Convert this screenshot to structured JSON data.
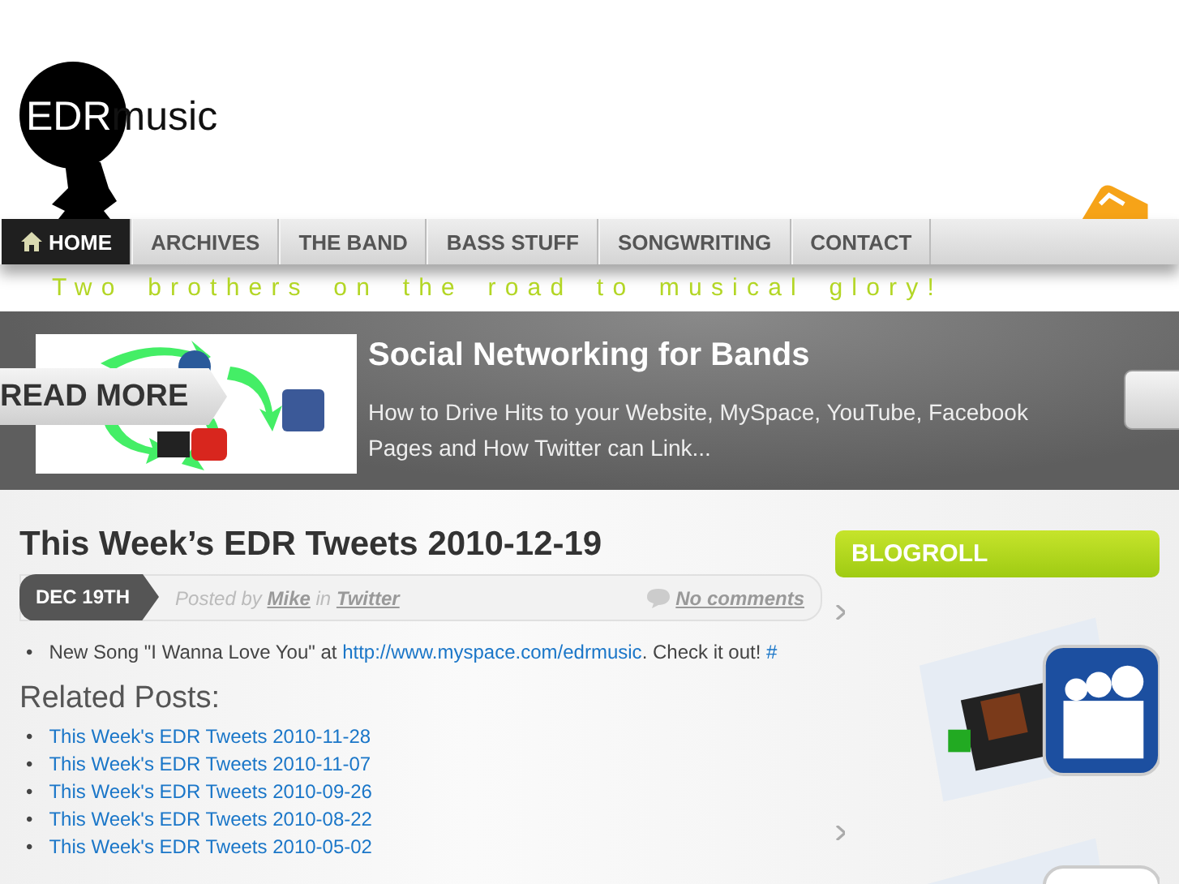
{
  "logo": {
    "first": "EDR",
    "second": "music"
  },
  "nav": [
    {
      "label": "HOME",
      "selected": true
    },
    {
      "label": "ARCHIVES",
      "selected": false
    },
    {
      "label": "THE BAND",
      "selected": false
    },
    {
      "label": "BASS STUFF",
      "selected": false
    },
    {
      "label": "SONGWRITING",
      "selected": false
    },
    {
      "label": "CONTACT",
      "selected": false
    }
  ],
  "tagline": "Two brothers on the road to musical glory!",
  "feature": {
    "title": "Social Networking for Bands",
    "excerpt": "How to Drive Hits to your Website, MySpace, YouTube,  Facebook Pages and How Twitter can Link...",
    "button": "READ MORE"
  },
  "post": {
    "title": "This Week’s EDR Tweets 2010-12-19",
    "date": "DEC 19TH",
    "posted_by": "Posted by",
    "author": "Mike",
    "in": "in",
    "category": "Twitter",
    "comments": "No comments",
    "items": [
      {
        "bullet": "•",
        "text": "New Song \"I Wanna Love You\" at ",
        "link": "http://www.myspace.com/edrmusic",
        "after": ". Check it out! ",
        "permalink": "#"
      }
    ]
  },
  "related": {
    "heading": "Related Posts:",
    "links": [
      {
        "bullet": "•",
        "title": "This Week's EDR Tweets 2010-11-28"
      },
      {
        "bullet": "•",
        "title": "This Week's EDR Tweets 2010-11-07"
      },
      {
        "bullet": "•",
        "title": "This Week's EDR Tweets 2010-09-26"
      },
      {
        "bullet": "•",
        "title": "This Week's EDR Tweets 2010-08-22"
      },
      {
        "bullet": "•",
        "title": "This Week's EDR Tweets 2010-05-02"
      }
    ]
  },
  "blogroll": {
    "heading": "BLOGROLL"
  }
}
